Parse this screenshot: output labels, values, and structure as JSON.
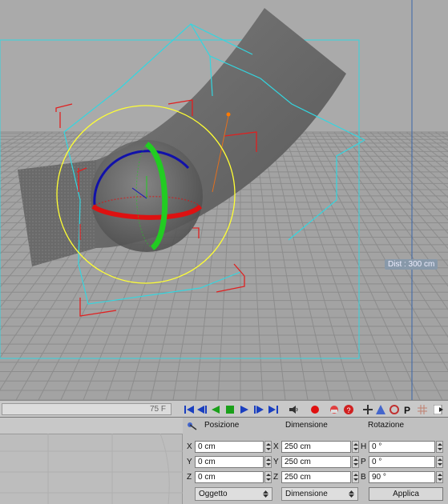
{
  "viewport": {
    "distance_label": "Dist : 300 cm"
  },
  "timebar": {
    "frame": "75 F"
  },
  "coordinates": {
    "headers": {
      "position": "Posizione",
      "dimension": "Dimensione",
      "rotation": "Rotazione"
    },
    "position": [
      {
        "axis": "X",
        "value": "0 cm"
      },
      {
        "axis": "Y",
        "value": "0 cm"
      },
      {
        "axis": "Z",
        "value": "0 cm"
      }
    ],
    "dimension": [
      {
        "axis": "X",
        "value": "250 cm"
      },
      {
        "axis": "Y",
        "value": "250 cm"
      },
      {
        "axis": "Z",
        "value": "250 cm"
      }
    ],
    "rotation": [
      {
        "axis": "H",
        "value": "0 °"
      },
      {
        "axis": "P",
        "value": "0 °"
      },
      {
        "axis": "B",
        "value": "90 °"
      }
    ],
    "mode_dropdown": "Oggetto",
    "size_dropdown": "Dimensione",
    "apply_label": "Applica"
  },
  "colors": {
    "viewport_bg": "#9e9e9e",
    "grid": "#8a8a8a",
    "surface": "#676767",
    "wire": "#33d6e0",
    "bbox": "#e02020",
    "selection_circle": "#ffff33",
    "axis_x": "#dd1111",
    "axis_y": "#22cc22",
    "axis_z": "#1111bb"
  }
}
